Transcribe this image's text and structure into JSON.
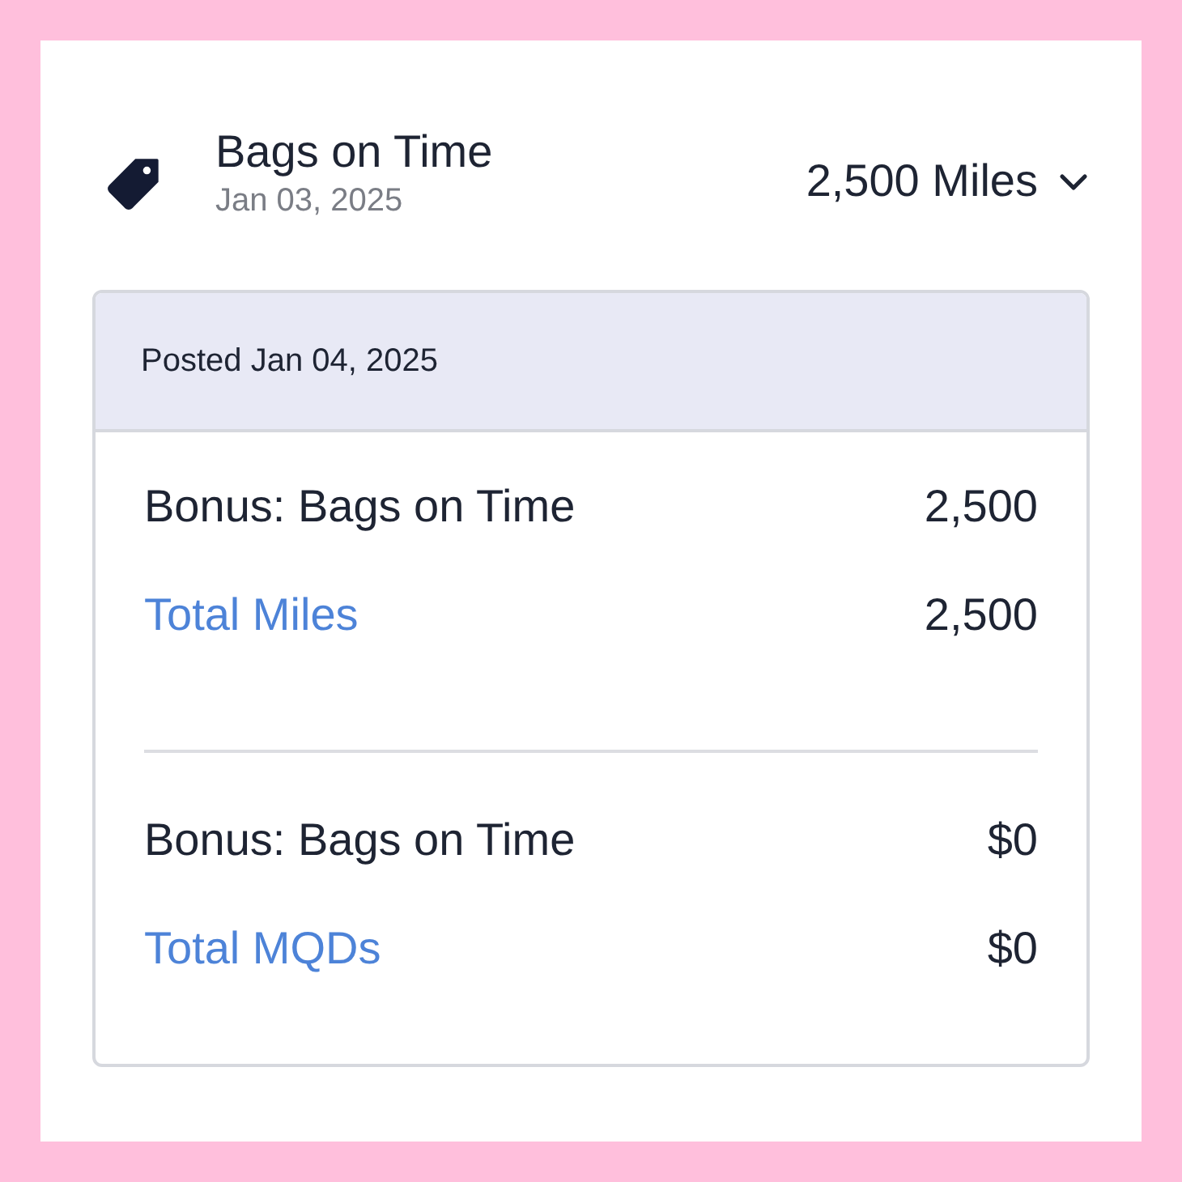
{
  "activity": {
    "title": "Bags on Time",
    "date": "Jan 03, 2025",
    "amount": "2,500 Miles",
    "expanded": true
  },
  "details": {
    "posted": "Posted Jan 04, 2025",
    "sections": [
      {
        "rows": [
          {
            "label": "Bonus: Bags on Time",
            "value": "2,500",
            "kind": "item"
          },
          {
            "label": "Total Miles",
            "value": "2,500",
            "kind": "total"
          }
        ]
      },
      {
        "rows": [
          {
            "label": "Bonus: Bags on Time",
            "value": "$0",
            "kind": "item"
          },
          {
            "label": "Total MQDs",
            "value": "$0",
            "kind": "total"
          }
        ]
      }
    ]
  }
}
